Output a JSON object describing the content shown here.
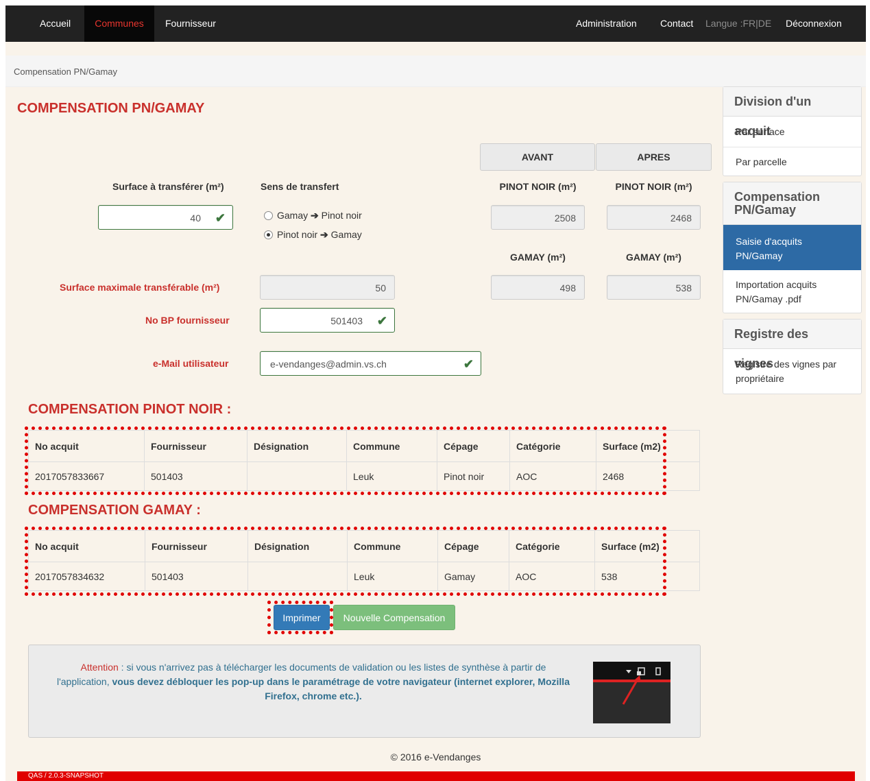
{
  "nav": {
    "accueil": "Accueil",
    "communes": "Communes",
    "fournisseur": "Fournisseur",
    "administration": "Administration",
    "contact": "Contact",
    "langue": "Langue :FR|DE",
    "deconnexion": "Déconnexion"
  },
  "breadcrumb": "Compensation PN/Gamay",
  "page_title": "COMPENSATION PN/GAMAY",
  "form": {
    "avant": "AVANT",
    "apres": "APRES",
    "surface_label": "Surface à transférer (m²)",
    "sens_label": "Sens de transfert",
    "surface_value": "40",
    "radio_1_a": "Gamay",
    "radio_1_b": "Pinot noir",
    "radio_2_a": "Pinot noir",
    "radio_2_b": "Gamay",
    "pinot_avant_label": "PINOT NOIR (m²)",
    "pinot_apres_label": "PINOT NOIR (m²)",
    "pinot_avant_value": "2508",
    "pinot_apres_value": "2468",
    "gamay_avant_label": "GAMAY (m²)",
    "gamay_apres_label": "GAMAY (m²)",
    "gamay_avant_value": "498",
    "gamay_apres_value": "538",
    "max_label": "Surface maximale transférable (m²)",
    "max_value": "50",
    "bp_label": "No BP fournisseur",
    "bp_value": "501403",
    "email_label": "e-Mail utilisateur",
    "email_value": "e-vendanges@admin.vs.ch"
  },
  "pinot_section": {
    "title": "COMPENSATION PINOT NOIR :",
    "headers": [
      "No acquit",
      "Fournisseur",
      "Désignation",
      "Commune",
      "Cépage",
      "Catégorie",
      "Surface (m2)"
    ],
    "row": [
      "2017057833667",
      "501403",
      "",
      "Leuk",
      "Pinot noir",
      "AOC",
      "2468"
    ]
  },
  "gamay_section": {
    "title": "COMPENSATION GAMAY :",
    "headers": [
      "No acquit",
      "Fournisseur",
      "Désignation",
      "Commune",
      "Cépage",
      "Catégorie",
      "Surface (m2)"
    ],
    "row": [
      "2017057834632",
      "501403",
      "",
      "Leuk",
      "Gamay",
      "AOC",
      "538"
    ]
  },
  "buttons": {
    "print": "Imprimer",
    "new": "Nouvelle Compensation"
  },
  "alert": {
    "attention": "Attention",
    "text1": " :  si vous n'arrivez pas à télécharger les documents de validation ou les listes de synthèse à partir de l'application, ",
    "text2": "vous devez débloquer les pop-up dans le paramétrage de votre navigateur (internet explorer, Mozilla Firefox, chrome etc.)."
  },
  "sidebar": {
    "division_title": "Division d'un acquit",
    "par_surface": "Par surface",
    "par_parcelle": "Par parcelle",
    "compensation_title": "Compensation PN/Gamay",
    "saisie": "Saisie d'acquits PN/Gamay",
    "importation": "Importation acquits PN/Gamay .pdf",
    "registre_title": "Registre des vignes",
    "registre_item": "Registre des vignes par propriétaire"
  },
  "footer": "© 2016 e-Vendanges",
  "version": "QAS / 2.0.3-SNAPSHOT"
}
